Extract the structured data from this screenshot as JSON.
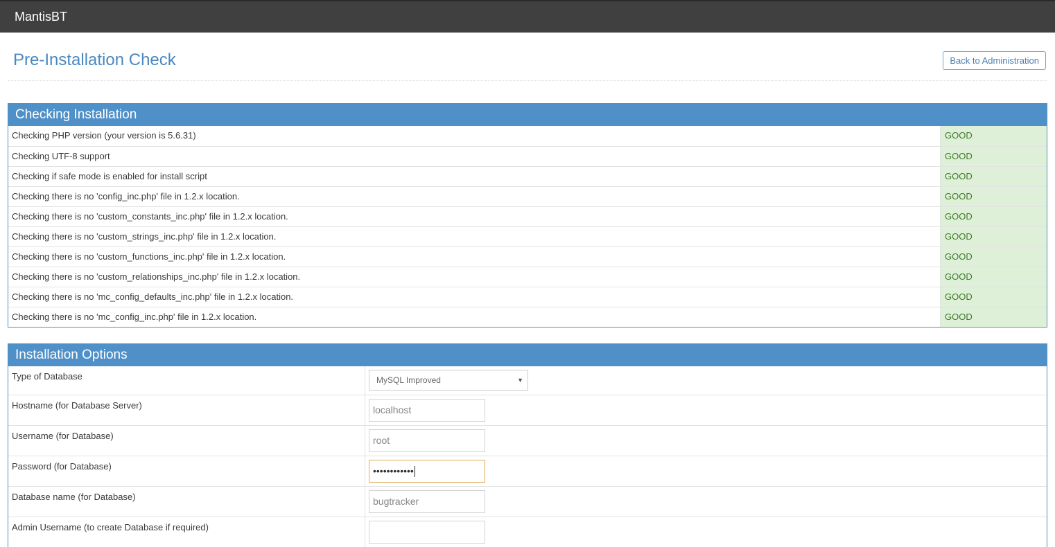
{
  "app": {
    "brand": "MantisBT"
  },
  "page": {
    "title": "Pre-Installation Check",
    "back_button": "Back to Administration"
  },
  "checking": {
    "heading": "Checking Installation",
    "rows": [
      {
        "label": "Checking PHP version (your version is 5.6.31)",
        "status": "GOOD"
      },
      {
        "label": "Checking UTF-8 support",
        "status": "GOOD"
      },
      {
        "label": "Checking if safe mode is enabled for install script",
        "status": "GOOD"
      },
      {
        "label": "Checking there is no 'config_inc.php' file in 1.2.x location.",
        "status": "GOOD"
      },
      {
        "label": "Checking there is no 'custom_constants_inc.php' file in 1.2.x location.",
        "status": "GOOD"
      },
      {
        "label": "Checking there is no 'custom_strings_inc.php' file in 1.2.x location.",
        "status": "GOOD"
      },
      {
        "label": "Checking there is no 'custom_functions_inc.php' file in 1.2.x location.",
        "status": "GOOD"
      },
      {
        "label": "Checking there is no 'custom_relationships_inc.php' file in 1.2.x location.",
        "status": "GOOD"
      },
      {
        "label": "Checking there is no 'mc_config_defaults_inc.php' file in 1.2.x location.",
        "status": "GOOD"
      },
      {
        "label": "Checking there is no 'mc_config_inc.php' file in 1.2.x location.",
        "status": "GOOD"
      }
    ],
    "status_color": "#dff0d8"
  },
  "options": {
    "heading": "Installation Options",
    "db_type": {
      "label": "Type of Database",
      "value": "MySQL Improved"
    },
    "hostname": {
      "label": "Hostname (for Database Server)",
      "value": "localhost"
    },
    "username": {
      "label": "Username (for Database)",
      "value": "root"
    },
    "password": {
      "label": "Password (for Database)",
      "value": "••••••••••••"
    },
    "dbname": {
      "label": "Database name (for Database)",
      "value": "bugtracker"
    },
    "admin_username": {
      "label": "Admin Username (to create Database if required)",
      "value": ""
    }
  },
  "colors": {
    "topbar": "#404040",
    "accent": "#5090c8",
    "good": "#dff0d8"
  }
}
